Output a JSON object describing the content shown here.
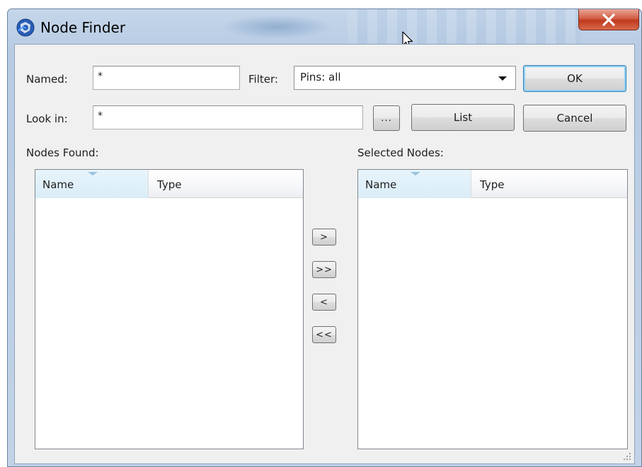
{
  "window": {
    "title": "Node Finder",
    "close_glyph": "X"
  },
  "form": {
    "named_label": "Named:",
    "named_value": "*",
    "filter_label": "Filter:",
    "filter_selected": "Pins: all",
    "lookin_label": "Look in:",
    "lookin_value": "*",
    "browse_label": "...",
    "ok_label": "OK",
    "list_label": "List",
    "cancel_label": "Cancel"
  },
  "nodes_found": {
    "label": "Nodes Found:",
    "columns": [
      "Name",
      "Type"
    ]
  },
  "selected_nodes": {
    "label": "Selected Nodes:",
    "columns": [
      "Name",
      "Type"
    ]
  },
  "transfer": {
    "add_one": ">",
    "add_all": ">>",
    "remove_one": "<",
    "remove_all": "<<"
  },
  "icons": [
    "app-icon",
    "close-icon",
    "dropdown-arrow-icon",
    "sort-indicator-icon",
    "mouse-cursor-icon",
    "resize-grip-icon"
  ]
}
